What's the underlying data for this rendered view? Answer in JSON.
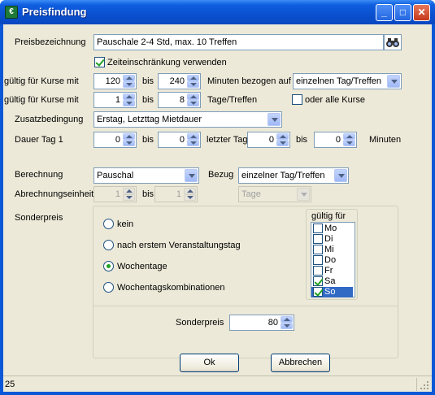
{
  "window": {
    "title": "Preisfindung",
    "app_icon_glyph": "€"
  },
  "labels": {
    "preisbezeichnung": "Preisbezeichnung",
    "gueltig1": "gültig für Kurse mit",
    "gueltig2": "gültig für Kurse mit",
    "bis1": "bis",
    "bis2": "bis",
    "minuten_bezogen": "Minuten bezogen auf",
    "tage_treffen": "Tage/Treffen",
    "zusatzbedingung": "Zusatzbedingung",
    "dauer_tag1": "Dauer Tag 1",
    "bis3": "bis",
    "letzter_tag": "letzter Tag",
    "bis4": "bis",
    "minuten": "Minuten",
    "berechnung": "Berechnung",
    "bezug": "Bezug",
    "abrechnungseinheit": "Abrechnungseinheit",
    "bis5": "bis",
    "sonderpreis_section": "Sonderpreis",
    "gueltig_fuer": "gültig für",
    "sonderpreis_field": "Sonderpreis"
  },
  "preisbezeichnung_value": "Pauschale 2-4 Std, max. 10 Treffen",
  "zeiteinschraenkung": {
    "label": "Zeiteinschränkung verwenden",
    "checked": true
  },
  "oder_alle_kurse": {
    "label": "oder alle Kurse",
    "checked": false
  },
  "spins": {
    "min_von": "120",
    "min_bis": "240",
    "tage_von": "1",
    "tage_bis": "8",
    "dauer_von": "0",
    "dauer_bis": "0",
    "letzter_von": "0",
    "letzter_bis": "0",
    "einheit_von": "1",
    "einheit_bis": "1",
    "sonderpreis": "80"
  },
  "combos": {
    "bezogen_auf": "einzelnen Tag/Treffen",
    "zusatzbedingung": "Erstag, Letzttag Mietdauer",
    "berechnung": "Pauschal",
    "bezug": "einzelner Tag/Treffen",
    "einheit": "Tage"
  },
  "radios": [
    {
      "label": "kein",
      "checked": false
    },
    {
      "label": "nach erstem Veranstaltungstag",
      "checked": false
    },
    {
      "label": "Wochentage",
      "checked": true
    },
    {
      "label": "Wochentagskombinationen",
      "checked": false
    }
  ],
  "days": [
    {
      "label": "Mo",
      "checked": false
    },
    {
      "label": "Di",
      "checked": false
    },
    {
      "label": "Mi",
      "checked": false
    },
    {
      "label": "Do",
      "checked": false
    },
    {
      "label": "Fr",
      "checked": false
    },
    {
      "label": "Sa",
      "checked": true
    },
    {
      "label": "So",
      "checked": true,
      "selected": true
    }
  ],
  "buttons": {
    "ok": "Ok",
    "cancel": "Abbrechen"
  },
  "status": {
    "count": "25"
  },
  "colors": {
    "titlebar": "#0a50d0",
    "dialog_bg": "#ece9d8",
    "check_green": "#21a121",
    "selection": "#316ac5"
  }
}
